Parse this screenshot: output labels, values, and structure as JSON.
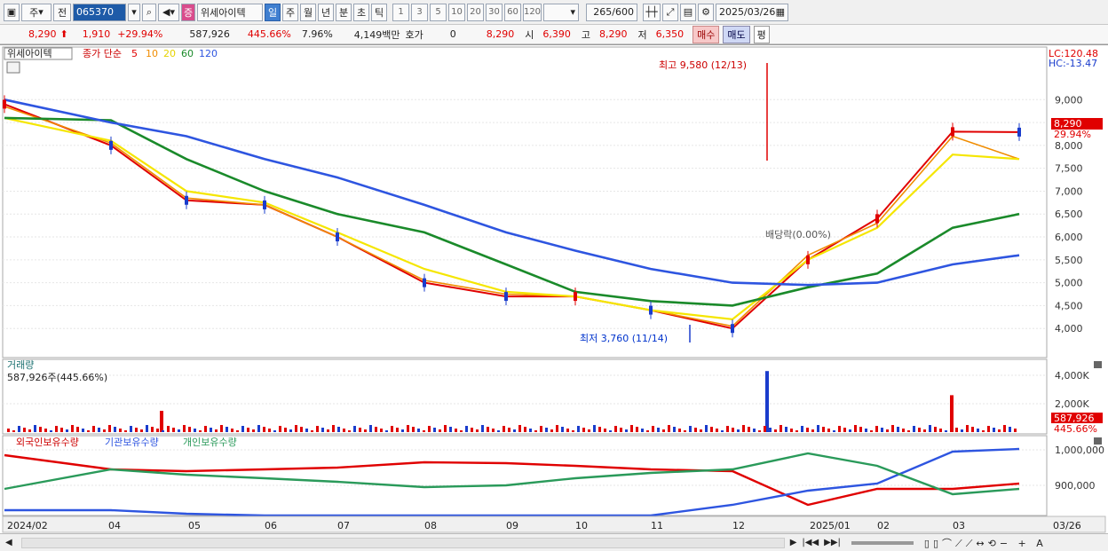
{
  "toolbar": {
    "type_select": "주",
    "view_select": "전",
    "stock_code": "065370",
    "stock_badge": "증",
    "stock_name": "위세아이텍",
    "tab_day": "일",
    "tab_week": "주",
    "tab_month": "월",
    "tab_year": "년",
    "tab_minute": "분",
    "tab_second": "초",
    "tab_tick": "틱",
    "periods": [
      "1",
      "3",
      "5",
      "10",
      "20",
      "30",
      "60",
      "120"
    ],
    "count": "265",
    "total": "/600",
    "date": "2025/03/26"
  },
  "info": {
    "price": "8,290",
    "change": "1,910",
    "change_pct": "+29.94%",
    "volume": "587,926",
    "volume_ratio": "445.66%",
    "turnover": "7.96%",
    "amount": "4,149백만",
    "quote_label": "호가",
    "quote_value": "0",
    "quote_price": "8,290",
    "open_label": "시",
    "open": "6,390",
    "high_label": "고",
    "high": "8,290",
    "low_label": "저",
    "low": "6,350",
    "buy_label": "매수",
    "sell_label": "매도",
    "avg_label": "평"
  },
  "price_panel": {
    "title": "위세아이텍",
    "legend_close": "종가 단순",
    "legend_ma": [
      "5",
      "10",
      "20",
      "60",
      "120"
    ],
    "lc": "LC:120.48",
    "hc": "HC:-13.47",
    "high_note": "최고 9,580 (12/13)",
    "low_note": "최저 3,760 (11/14)",
    "dividend_note": "배당락(0.00%)",
    "current_price_tag": "8,290",
    "current_pct_tag": "29.94%"
  },
  "volume_panel": {
    "title": "거래량",
    "subtitle": "587,926주(445.66%)",
    "current_tag": "587,926",
    "current_pct_tag": "445.66%"
  },
  "holdings_panel": {
    "legend": [
      "외국인보유수량",
      "기관보유수량",
      "개인보유수량"
    ]
  },
  "x_axis_labels": [
    "2024/02",
    "04",
    "05",
    "06",
    "07",
    "08",
    "09",
    "10",
    "11",
    "12",
    "2025/01",
    "02",
    "03",
    "03/26"
  ],
  "colors": {
    "up": "#e00000",
    "down": "#1a3ccc",
    "ma5": "#e00000",
    "ma10": "#f08c00",
    "ma20": "#f5e600",
    "ma60": "#1a8a2a",
    "ma120": "#2e55e0",
    "foreign": "#e00000",
    "institution": "#2e55e0",
    "individual": "#2a9a5a"
  },
  "chart_data": [
    {
      "type": "line",
      "title": "위세아이텍",
      "x": [
        "2024/02",
        "04",
        "05",
        "06",
        "07",
        "08",
        "09",
        "10",
        "11",
        "12",
        "2025/01",
        "02",
        "03",
        "03/26"
      ],
      "series": [
        {
          "name": "종가",
          "values": [
            8900,
            8000,
            6800,
            6700,
            6000,
            5000,
            4700,
            4700,
            4400,
            4000,
            5500,
            6400,
            8300,
            8290
          ]
        },
        {
          "name": "5",
          "values": [
            8900,
            8000,
            6800,
            6700,
            6000,
            5000,
            4700,
            4700,
            4400,
            4000,
            5500,
            6400,
            8300,
            8290
          ]
        },
        {
          "name": "10",
          "values": [
            8850,
            8050,
            6850,
            6700,
            6000,
            5050,
            4750,
            4700,
            4400,
            4050,
            5600,
            6300,
            8200,
            7700
          ]
        },
        {
          "name": "20",
          "values": [
            8600,
            8100,
            7000,
            6750,
            6100,
            5300,
            4800,
            4700,
            4400,
            4200,
            5500,
            6200,
            7800,
            7700
          ]
        },
        {
          "name": "60",
          "values": [
            8600,
            8550,
            7700,
            7000,
            6500,
            6100,
            5400,
            4800,
            4600,
            4500,
            4900,
            5200,
            6200,
            6500
          ]
        },
        {
          "name": "120",
          "values": [
            9000,
            8500,
            8200,
            7700,
            7300,
            6700,
            6100,
            5700,
            5300,
            5000,
            4950,
            5000,
            5400,
            5600
          ]
        }
      ],
      "ylim": [
        3500,
        9800
      ],
      "yticks": [
        4000,
        4500,
        5000,
        5500,
        6000,
        6500,
        7000,
        7500,
        8000,
        8500,
        9000
      ]
    },
    {
      "type": "bar",
      "title": "거래량",
      "yticks": [
        "2,000K",
        "4,000K"
      ],
      "ylim": [
        0,
        4500
      ],
      "peaks": [
        {
          "x": "12",
          "value": 4300
        },
        {
          "x": "03",
          "value": 2600
        },
        {
          "x": "04",
          "value": 1500
        }
      ]
    },
    {
      "type": "line",
      "yticks": [
        "900,000",
        "1,000,000"
      ],
      "series": [
        {
          "name": "외국인보유수량"
        },
        {
          "name": "기관보유수량"
        },
        {
          "name": "개인보유수량"
        }
      ]
    }
  ]
}
